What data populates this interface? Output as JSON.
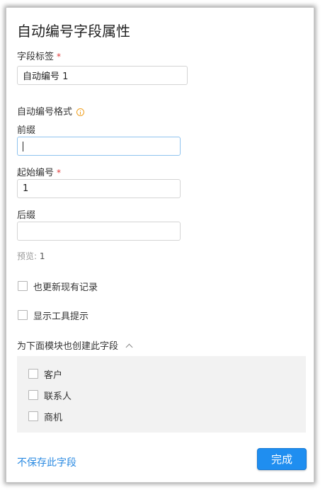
{
  "dialog": {
    "title": "自动编号字段属性"
  },
  "field_label": {
    "label": "字段标签",
    "required_mark": "*",
    "value": "自动编号 1"
  },
  "format": {
    "section_label": "自动编号格式",
    "prefix": {
      "label": "前缀",
      "value": ""
    },
    "start_number": {
      "label": "起始编号",
      "required_mark": "*",
      "value": "1"
    },
    "suffix": {
      "label": "后缀",
      "value": ""
    },
    "preview": {
      "label": "预览:",
      "value": "1"
    }
  },
  "options": {
    "update_existing": {
      "label": "也更新现有记录",
      "checked": false
    },
    "show_tooltip": {
      "label": "显示工具提示",
      "checked": false
    }
  },
  "modules": {
    "header": "为下面模块也创建此字段",
    "expanded": true,
    "items": [
      {
        "label": "客户",
        "checked": false
      },
      {
        "label": "联系人",
        "checked": false
      },
      {
        "label": "商机",
        "checked": false
      }
    ]
  },
  "footer": {
    "discard_link": "不保存此字段",
    "done_button": "完成"
  },
  "colors": {
    "accent": "#1f8ef0",
    "link": "#2a8ae2",
    "required": "#e03a3a",
    "info_icon": "#f0a020",
    "module_panel_bg": "#f2f2f2"
  },
  "icons": {
    "info": "info-circle-icon",
    "chevron": "chevron-up-icon"
  }
}
